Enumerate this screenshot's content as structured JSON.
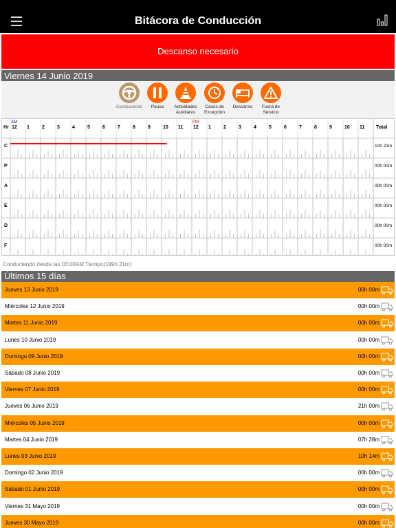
{
  "header": {
    "title": "Bitácora de Conducción",
    "menu_icon": "hamburger-menu-icon",
    "report_icon": "bar-chart-icon"
  },
  "alert": {
    "text": "Descanso necesario",
    "color": "#ff0000"
  },
  "today": {
    "title": "Viernes 14 Junio 2019"
  },
  "statuses": [
    {
      "label": "Conduciendo",
      "icon": "steering-wheel-icon",
      "color": "#b89a6a"
    },
    {
      "label": "Pausa",
      "icon": "pause-icon",
      "color": "#ff6a00"
    },
    {
      "label": "Actividades Auxiliares",
      "icon": "traffic-cone-icon",
      "color": "#ff6a00"
    },
    {
      "label": "Casos de Excepción",
      "icon": "clock-alert-icon",
      "color": "#ff6a00"
    },
    {
      "label": "Descanso",
      "icon": "bed-icon",
      "color": "#ff6a00"
    },
    {
      "label": "Fuera de Servicio",
      "icon": "warning-icon",
      "color": "#ff6a00"
    }
  ],
  "grid": {
    "hr_label": "Hr",
    "am_label": "AM",
    "pm_label": "PM",
    "total_label": "Total",
    "hours": [
      "12",
      "1",
      "2",
      "3",
      "4",
      "5",
      "6",
      "7",
      "8",
      "9",
      "10",
      "11",
      "12",
      "1",
      "2",
      "3",
      "4",
      "5",
      "6",
      "7",
      "8",
      "9",
      "10",
      "11"
    ],
    "rows": [
      {
        "code": "C",
        "total": "10h 21m",
        "active_from_hour": 0,
        "active_to_hour": 10.35
      },
      {
        "code": "P",
        "total": "00h 00m"
      },
      {
        "code": "A",
        "total": "00h 00m"
      },
      {
        "code": "E",
        "total": "00h 00m"
      },
      {
        "code": "D",
        "total": "00h 00m"
      },
      {
        "code": "F",
        "total": "00h 00m"
      }
    ],
    "line_color": "#ff0000"
  },
  "footnote": "Conduciendo desde las 03:00AM Tiempo(199h 21m)",
  "history": {
    "title": "Últimos 15 días",
    "days": [
      {
        "name": "Jueves 13 Junio 2019",
        "hours": "00h 00m",
        "style": "orange"
      },
      {
        "name": "Miércoles 12 Junio 2019",
        "hours": "00h 00m",
        "style": "white"
      },
      {
        "name": "Martes 11 Junio 2019",
        "hours": "00h 00m",
        "style": "orange"
      },
      {
        "name": "Lunes 10 Junio 2019",
        "hours": "00h 00m",
        "style": "white"
      },
      {
        "name": "Domingo 09 Junio 2019",
        "hours": "00h 00m",
        "style": "orange"
      },
      {
        "name": "Sábado 08 Junio 2019",
        "hours": "00h 00m",
        "style": "white"
      },
      {
        "name": "Viernes 07 Junio 2019",
        "hours": "00h 00m",
        "style": "orange"
      },
      {
        "name": "Jueves 06 Junio 2019",
        "hours": "21h 00m",
        "style": "white"
      },
      {
        "name": "Miércoles 05 Junio 2019",
        "hours": "00h 00m",
        "style": "orange"
      },
      {
        "name": "Martes 04 Junio 2019",
        "hours": "07h 28m",
        "style": "white"
      },
      {
        "name": "Lunes 03 Junio 2019",
        "hours": "10h 14m",
        "style": "orange"
      },
      {
        "name": "Domingo 02 Junio 2019",
        "hours": "00h 00m",
        "style": "white"
      },
      {
        "name": "Sábado 01 Junio 2019",
        "hours": "00h 00m",
        "style": "orange"
      },
      {
        "name": "Viernes 31 Mayo 2019",
        "hours": "00h 00m",
        "style": "white"
      },
      {
        "name": "Jueves 30 Mayo 2019",
        "hours": "00h 00m",
        "style": "orange"
      }
    ]
  }
}
